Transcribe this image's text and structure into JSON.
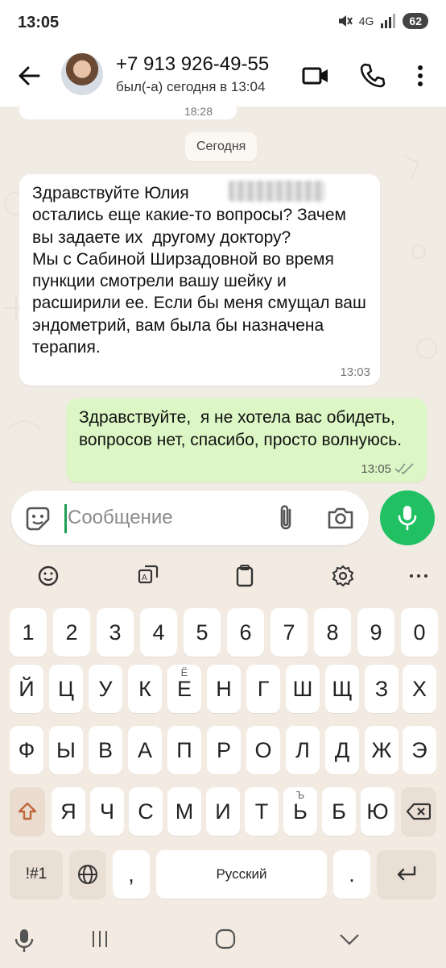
{
  "status_bar": {
    "time": "13:05",
    "network": "4G",
    "battery": "62"
  },
  "header": {
    "contact_name": "+7 913 926-49-55",
    "last_seen": "был(-а) сегодня в 13:04"
  },
  "chat": {
    "previous_time": "18:28",
    "date_chip": "Сегодня",
    "incoming": {
      "text": "Здравствуйте Юлия            . У вас остались еще какие-то вопросы? Зачем вы задаете их  другому доктору?\nМы с Сабиной Ширзадовной во время пункции смотрели вашу шейку и расширили ее. Если бы меня смущал ваш эндометрий, вам была бы назначена терапия.",
      "time": "13:03"
    },
    "outgoing": {
      "text": "Здравствуйте,  я не хотела вас обидеть, вопросов нет, спасибо, просто волнуюсь.",
      "time": "13:05",
      "status": "read"
    }
  },
  "composer": {
    "placeholder": "Сообщение"
  },
  "keyboard": {
    "number_row": [
      "1",
      "2",
      "3",
      "4",
      "5",
      "6",
      "7",
      "8",
      "9",
      "0"
    ],
    "row1": [
      "Й",
      "Ц",
      "У",
      "К",
      "Е",
      "Н",
      "Г",
      "Ш",
      "Щ",
      "З",
      "Х"
    ],
    "row1_sup": {
      "Е": "Ё"
    },
    "row2": [
      "Ф",
      "Ы",
      "В",
      "А",
      "П",
      "Р",
      "О",
      "Л",
      "Д",
      "Ж",
      "Э"
    ],
    "row3": [
      "Я",
      "Ч",
      "С",
      "М",
      "И",
      "Т",
      "Ь",
      "Б",
      "Ю"
    ],
    "row3_sup": {
      "Ь": "Ъ"
    },
    "symbols_label": "!#1",
    "comma": ",",
    "space_label": "Русский",
    "period": "."
  },
  "colors": {
    "accent": "#21c063",
    "outgoing_bubble": "#dcf7c5",
    "chat_bg": "#f1ece3"
  }
}
